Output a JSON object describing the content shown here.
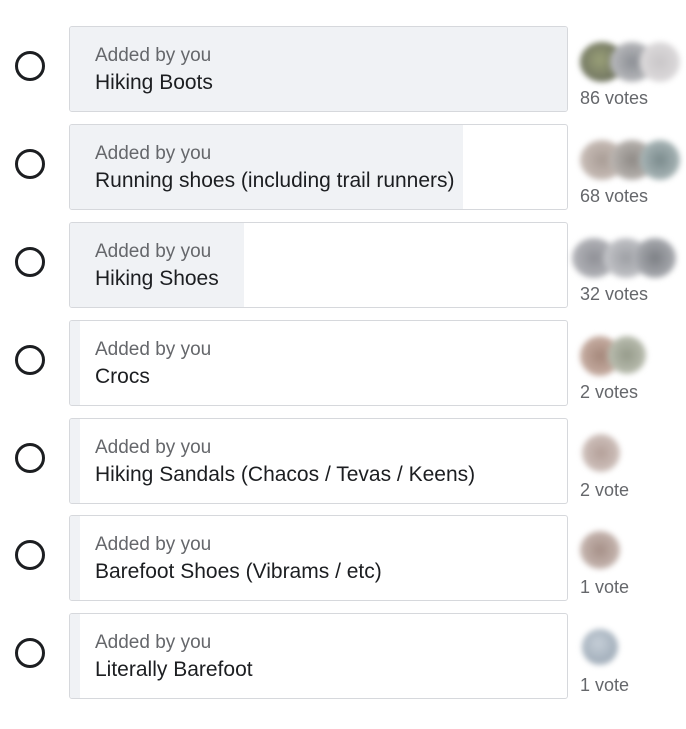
{
  "poll": {
    "options": [
      {
        "added_by": "Added by you",
        "label": "Hiking Boots",
        "votes_text": "86 votes",
        "votes": 86,
        "fill_fraction": 1.0
      },
      {
        "added_by": "Added by you",
        "label": "Running shoes (including trail runners)",
        "votes_text": "68 votes",
        "votes": 68,
        "fill_fraction": 0.79
      },
      {
        "added_by": "Added by you",
        "label": "Hiking Shoes",
        "votes_text": "32 votes",
        "votes": 32,
        "fill_fraction": 0.35
      },
      {
        "added_by": "Added by you",
        "label": "Crocs",
        "votes_text": "2 votes",
        "votes": 2,
        "fill_fraction": 0.02
      },
      {
        "added_by": "Added by you",
        "label": "Hiking Sandals (Chacos / Tevas / Keens)",
        "votes_text": "2 vote",
        "votes": 2,
        "fill_fraction": 0.01
      },
      {
        "added_by": "Added by you",
        "label": "Barefoot Shoes (Vibrams / etc)",
        "votes_text": "1 vote",
        "votes": 1,
        "fill_fraction": 0.01
      },
      {
        "added_by": "Added by you",
        "label": "Literally Barefoot",
        "votes_text": "1 vote",
        "votes": 1,
        "fill_fraction": 0.01
      }
    ]
  },
  "colors": {
    "bar_fill": "#f0f2f5",
    "border": "#d6d8dc",
    "text_primary": "#1c1e21",
    "text_secondary": "#65676b"
  }
}
